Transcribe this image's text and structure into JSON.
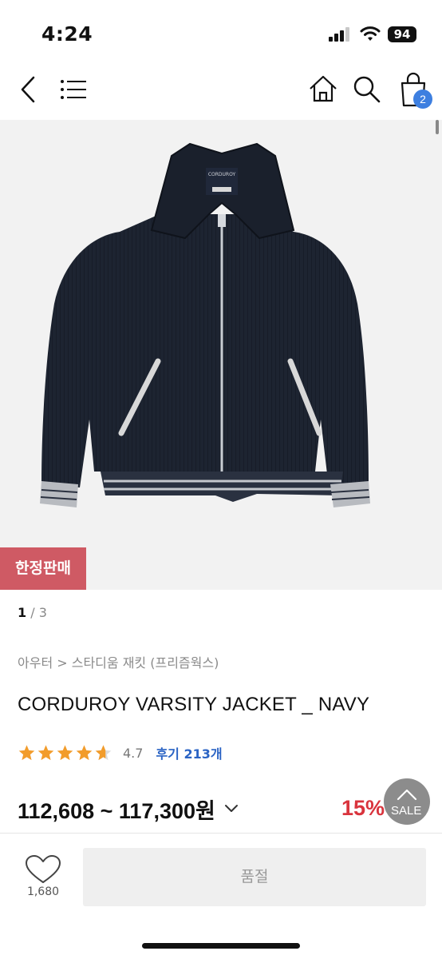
{
  "status": {
    "time": "4:24",
    "battery": "94"
  },
  "cart": {
    "count": "2"
  },
  "product": {
    "limited_badge": "한정판매",
    "pager_current": "1",
    "pager_total": "/ 3",
    "breadcrumb": "아우터 > 스타디움 재킷 (프리즘웍스)",
    "title": "CORDUROY VARSITY JACKET _ NAVY",
    "rating": "4.7",
    "review_label": "후기 213개",
    "price": "112,608 ~ 117,300원",
    "discount": "15%",
    "sale_label": "SALE",
    "star_color": "#f29c2b",
    "jacket_color": "#1d2431"
  },
  "bottom": {
    "like_count": "1,680",
    "soldout_label": "품절"
  }
}
